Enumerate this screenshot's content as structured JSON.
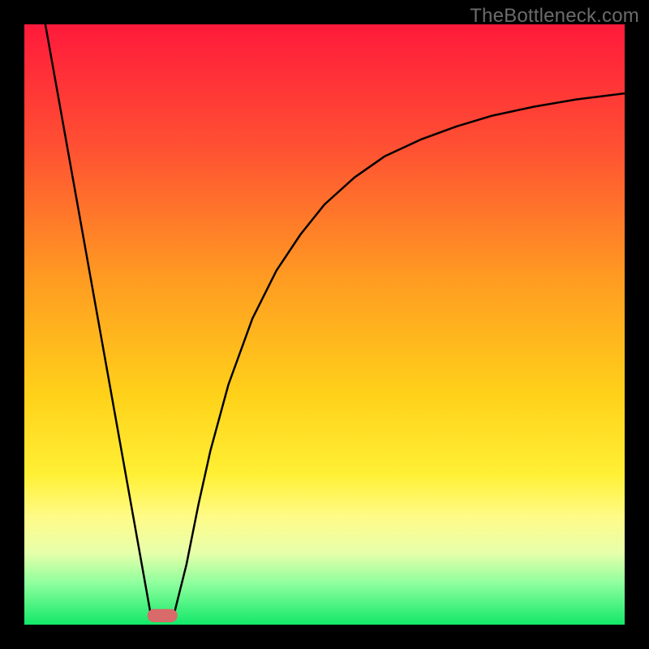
{
  "watermark": "TheBottleneck.com",
  "chart_data": {
    "type": "line",
    "title": "",
    "xlabel": "",
    "ylabel": "",
    "xlim": [
      0,
      100
    ],
    "ylim": [
      0,
      100
    ],
    "gradient_stops": [
      {
        "offset": 0,
        "color": "#ff1a3b"
      },
      {
        "offset": 20,
        "color": "#ff4f33"
      },
      {
        "offset": 42,
        "color": "#ff9a22"
      },
      {
        "offset": 62,
        "color": "#ffd21a"
      },
      {
        "offset": 75,
        "color": "#fff035"
      },
      {
        "offset": 82,
        "color": "#fffb87"
      },
      {
        "offset": 88,
        "color": "#e7ffab"
      },
      {
        "offset": 93,
        "color": "#90ff9e"
      },
      {
        "offset": 100,
        "color": "#12e86a"
      }
    ],
    "series": [
      {
        "name": "left-line",
        "x": [
          3.5,
          21.0
        ],
        "y": [
          100.0,
          2.0
        ]
      },
      {
        "name": "right-curve",
        "x": [
          25.0,
          27.0,
          29.0,
          31.0,
          34.0,
          38.0,
          42.0,
          46.0,
          50.0,
          55.0,
          60.0,
          66.0,
          72.0,
          78.0,
          85.0,
          92.0,
          100.0
        ],
        "y": [
          2.0,
          10.0,
          20.0,
          29.0,
          40.0,
          51.0,
          59.0,
          65.0,
          70.0,
          74.5,
          78.0,
          80.8,
          83.0,
          84.8,
          86.3,
          87.5,
          88.5
        ]
      }
    ],
    "marker": {
      "x_center": 23.0,
      "y_center": 1.5,
      "width": 5.0,
      "height": 2.2,
      "color": "#d86a6a"
    }
  }
}
